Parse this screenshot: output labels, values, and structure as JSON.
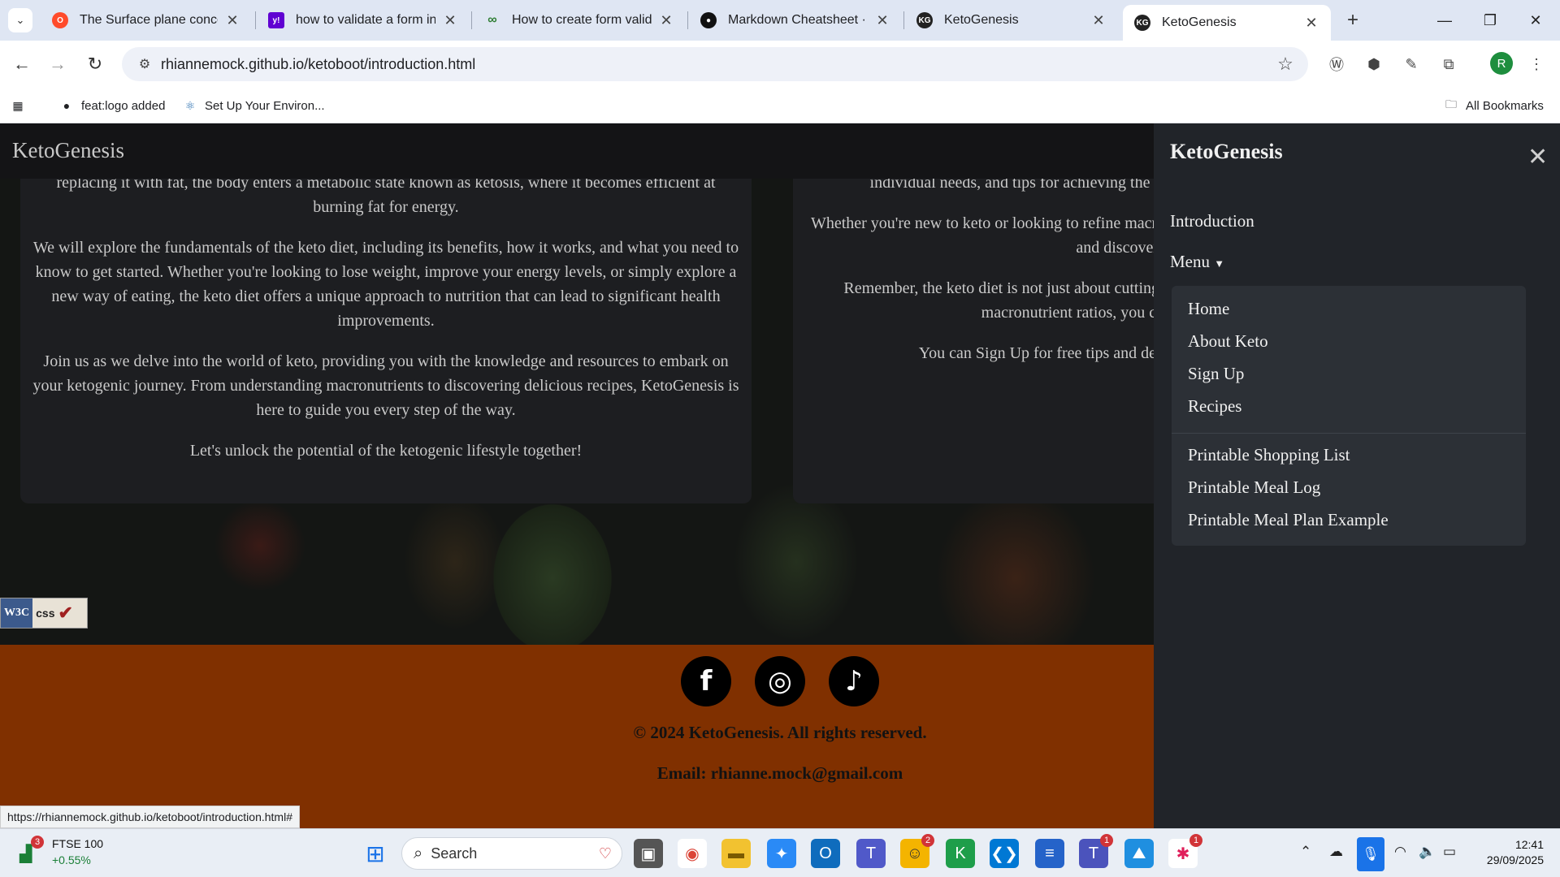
{
  "browser": {
    "tabs": [
      {
        "title": "The Surface plane concerns",
        "icon": "opera-icon"
      },
      {
        "title": "how to validate a form in js",
        "icon": "yahoo-icon"
      },
      {
        "title": "How to create form validation",
        "icon": "infinity-icon"
      },
      {
        "title": "Markdown Cheatsheet · ad",
        "icon": "github-icon"
      },
      {
        "title": "KetoGenesis",
        "icon": "kg-icon"
      },
      {
        "title": "KetoGenesis",
        "icon": "kg-icon",
        "active": true
      }
    ],
    "url": "rhiannemock.github.io/ketoboot/introduction.html",
    "profile_initial": "R",
    "bookmarks": [
      "feat:logo added",
      "Set Up Your Environ..."
    ],
    "all_bookmarks": "All Bookmarks",
    "status_url": "https://rhiannemock.github.io/ketoboot/introduction.html#"
  },
  "site": {
    "brand": "KetoGenesis",
    "left_card": {
      "p0": "replacing it with fat, the body enters a metabolic state known as ketosis, where it becomes efficient at burning fat for energy.",
      "p1": "We will explore the fundamentals of the keto diet, including its benefits, how it works, and what you need to know to get started. Whether you're looking to lose weight, improve your energy levels, or simply explore a new way of eating, the keto diet offers a unique approach to nutrition that can lead to significant health improvements.",
      "p2": "Join us as we delve into the world of keto, providing you with the knowledge and resources to embark on your ketogenic journey. From understanding macronutrients to discovering delicious recipes, KetoGenesis is here to guide you every step of the way.",
      "p3": "Let's unlock the potential of the ketogenic lifestyle together!"
    },
    "right_card": {
      "p0": "individual needs, and tips for achieving the right bo can optimize your ketogenic journey",
      "p1": "Whether you're new to keto or looking to refine macronutrient intake is key to achieving your healt macros and discover how they ca",
      "p2": "Remember, the keto diet is not just about cutting c prioritizes healthy fats and proteins while min macronutrient ratios, you can fuel your body effect me",
      "p3": "You can Sign Up for free tips and delicious recipes accounts, links are at t"
    },
    "w3c": {
      "w3": "W3C",
      "css": "css"
    },
    "footer": {
      "copyright": "© 2024 KetoGenesis. All rights reserved.",
      "email": "Email: rhianne.mock@gmail.com",
      "social": [
        {
          "name": "facebook",
          "glyph": "f"
        },
        {
          "name": "instagram",
          "glyph": "◎"
        },
        {
          "name": "tiktok",
          "glyph": "♪"
        }
      ]
    }
  },
  "offcanvas": {
    "title": "KetoGenesis",
    "introduction": "Introduction",
    "menu": "Menu",
    "dropdown": {
      "primary": [
        "Home",
        "About Keto",
        "Sign Up",
        "Recipes"
      ],
      "printables": [
        "Printable Shopping List",
        "Printable Meal Log",
        "Printable Meal Plan Example"
      ]
    }
  },
  "taskbar": {
    "stock": {
      "name": "FTSE 100",
      "change": "+0.55%",
      "badge": "3"
    },
    "search_placeholder": "Search",
    "badges": {
      "teams_chat": "2",
      "teams": "1",
      "slack": "1"
    },
    "time": "12:41",
    "date": "29/09/2025"
  }
}
